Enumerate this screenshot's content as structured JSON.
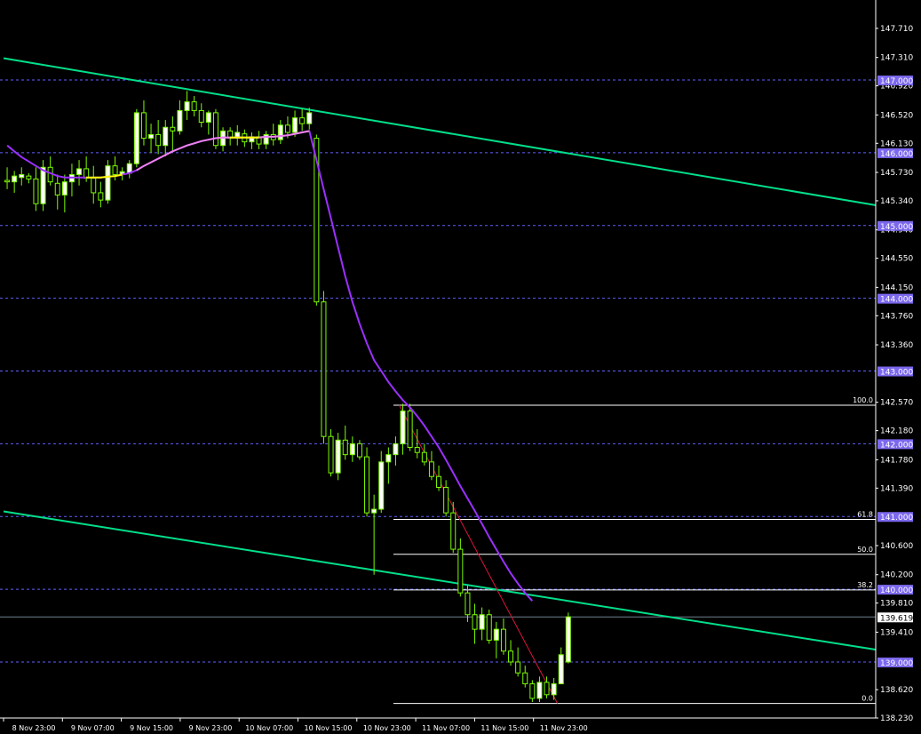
{
  "chart_data": {
    "type": "candlestick",
    "colors": {
      "background": "#000000",
      "frame": "#ffffff",
      "bull_body": "#ffffff",
      "bull_border": "#7cfc00",
      "bear_body": "#000000",
      "wick": "#7cfc00",
      "channel": "#00e08a",
      "moving_average": "#9b30ff",
      "moving_average_light": "#ee82ee",
      "moving_average_flat": "#ffff00",
      "fib": "#ffffff",
      "trend": "#dc143c",
      "round_level": "#6060ff",
      "round_tag": "#7b68ee",
      "current_price_line": "#708090"
    },
    "y_range": [
      138.23,
      148.1
    ],
    "y_ticks": [
      "147.710",
      "147.310",
      "146.920",
      "146.520",
      "146.130",
      "145.730",
      "145.340",
      "144.940",
      "144.550",
      "144.150",
      "143.760",
      "143.360",
      "142.570",
      "142.180",
      "141.780",
      "141.390",
      "140.600",
      "140.200",
      "139.810",
      "139.410",
      "138.620",
      "138.230"
    ],
    "round_levels": [
      "147.000",
      "146.000",
      "145.000",
      "144.000",
      "143.000",
      "142.000",
      "141.000",
      "140.000",
      "139.000"
    ],
    "current_price": "139.619",
    "x_labels": [
      "8 Nov 23:00",
      "9 Nov 07:00",
      "9 Nov 15:00",
      "9 Nov 23:00",
      "10 Nov 07:00",
      "10 Nov 15:00",
      "10 Nov 23:00",
      "11 Nov 07:00",
      "11 Nov 15:00",
      "11 Nov 23:00"
    ],
    "fib_levels": [
      {
        "label": "100.0",
        "price": 142.53
      },
      {
        "label": "61.8",
        "price": 140.96
      },
      {
        "label": "50.0",
        "price": 140.48
      },
      {
        "label": "38.2",
        "price": 139.99
      },
      {
        "label": "0.0",
        "price": 138.43
      }
    ],
    "channel_lines": [
      {
        "from_bar": 0,
        "from_price": 147.3,
        "to_bar": 121.2,
        "to_price": 145.28
      },
      {
        "from_bar": 0,
        "from_price": 141.07,
        "to_bar": 121.2,
        "to_price": 139.17
      }
    ],
    "trend_line": {
      "from_bar": 55,
      "from_price": 142.53,
      "to_bar": 77,
      "to_price": 138.43
    },
    "candles": [
      {
        "o": 145.62,
        "h": 145.8,
        "l": 145.5,
        "c": 145.6
      },
      {
        "o": 145.6,
        "h": 145.75,
        "l": 145.45,
        "c": 145.68
      },
      {
        "o": 145.66,
        "h": 145.8,
        "l": 145.55,
        "c": 145.7
      },
      {
        "o": 145.68,
        "h": 145.72,
        "l": 145.58,
        "c": 145.64
      },
      {
        "o": 145.64,
        "h": 145.8,
        "l": 145.2,
        "c": 145.3
      },
      {
        "o": 145.3,
        "h": 145.9,
        "l": 145.2,
        "c": 145.8
      },
      {
        "o": 145.8,
        "h": 145.95,
        "l": 145.55,
        "c": 145.6
      },
      {
        "o": 145.58,
        "h": 145.7,
        "l": 145.22,
        "c": 145.42
      },
      {
        "o": 145.42,
        "h": 145.7,
        "l": 145.18,
        "c": 145.6
      },
      {
        "o": 145.6,
        "h": 145.85,
        "l": 145.4,
        "c": 145.7
      },
      {
        "o": 145.7,
        "h": 145.9,
        "l": 145.55,
        "c": 145.78
      },
      {
        "o": 145.78,
        "h": 145.95,
        "l": 145.6,
        "c": 145.65
      },
      {
        "o": 145.65,
        "h": 145.82,
        "l": 145.3,
        "c": 145.45
      },
      {
        "o": 145.45,
        "h": 145.6,
        "l": 145.25,
        "c": 145.35
      },
      {
        "o": 145.35,
        "h": 145.9,
        "l": 145.3,
        "c": 145.82
      },
      {
        "o": 145.82,
        "h": 145.95,
        "l": 145.62,
        "c": 145.7
      },
      {
        "o": 145.7,
        "h": 145.8,
        "l": 145.62,
        "c": 145.74
      },
      {
        "o": 145.72,
        "h": 145.9,
        "l": 145.65,
        "c": 145.85
      },
      {
        "o": 145.85,
        "h": 146.6,
        "l": 145.8,
        "c": 146.55
      },
      {
        "o": 146.55,
        "h": 146.72,
        "l": 146.1,
        "c": 146.2
      },
      {
        "o": 146.2,
        "h": 146.4,
        "l": 146.0,
        "c": 146.25
      },
      {
        "o": 146.25,
        "h": 146.45,
        "l": 145.98,
        "c": 146.1
      },
      {
        "o": 146.1,
        "h": 146.45,
        "l": 145.95,
        "c": 146.35
      },
      {
        "o": 146.35,
        "h": 146.5,
        "l": 146.02,
        "c": 146.3
      },
      {
        "o": 146.3,
        "h": 146.72,
        "l": 146.25,
        "c": 146.58
      },
      {
        "o": 146.58,
        "h": 146.85,
        "l": 146.45,
        "c": 146.7
      },
      {
        "o": 146.7,
        "h": 146.78,
        "l": 146.5,
        "c": 146.58
      },
      {
        "o": 146.58,
        "h": 146.68,
        "l": 146.35,
        "c": 146.42
      },
      {
        "o": 146.42,
        "h": 146.58,
        "l": 146.25,
        "c": 146.55
      },
      {
        "o": 146.55,
        "h": 146.6,
        "l": 146.05,
        "c": 146.1
      },
      {
        "o": 146.1,
        "h": 146.35,
        "l": 146.02,
        "c": 146.3
      },
      {
        "o": 146.3,
        "h": 146.35,
        "l": 146.1,
        "c": 146.2
      },
      {
        "o": 146.2,
        "h": 146.38,
        "l": 146.1,
        "c": 146.28
      },
      {
        "o": 146.26,
        "h": 146.32,
        "l": 146.08,
        "c": 146.15
      },
      {
        "o": 146.15,
        "h": 146.28,
        "l": 146.05,
        "c": 146.22
      },
      {
        "o": 146.22,
        "h": 146.3,
        "l": 146.05,
        "c": 146.12
      },
      {
        "o": 146.12,
        "h": 146.3,
        "l": 146.05,
        "c": 146.25
      },
      {
        "o": 146.25,
        "h": 146.4,
        "l": 146.1,
        "c": 146.18
      },
      {
        "o": 146.18,
        "h": 146.45,
        "l": 146.12,
        "c": 146.38
      },
      {
        "o": 146.38,
        "h": 146.5,
        "l": 146.2,
        "c": 146.28
      },
      {
        "o": 146.28,
        "h": 146.58,
        "l": 146.22,
        "c": 146.48
      },
      {
        "o": 146.48,
        "h": 146.6,
        "l": 146.3,
        "c": 146.4
      },
      {
        "o": 146.4,
        "h": 146.62,
        "l": 146.32,
        "c": 146.55
      },
      {
        "o": 146.2,
        "h": 146.25,
        "l": 143.9,
        "c": 143.95
      },
      {
        "o": 143.95,
        "h": 144.1,
        "l": 142.0,
        "c": 142.1
      },
      {
        "o": 142.1,
        "h": 142.2,
        "l": 141.55,
        "c": 141.6
      },
      {
        "o": 141.6,
        "h": 142.15,
        "l": 141.5,
        "c": 142.05
      },
      {
        "o": 142.05,
        "h": 142.25,
        "l": 141.78,
        "c": 141.85
      },
      {
        "o": 141.85,
        "h": 142.1,
        "l": 141.75,
        "c": 142.0
      },
      {
        "o": 142.0,
        "h": 142.05,
        "l": 141.78,
        "c": 141.82
      },
      {
        "o": 141.82,
        "h": 141.95,
        "l": 141.0,
        "c": 141.05
      },
      {
        "o": 141.05,
        "h": 141.3,
        "l": 140.2,
        "c": 141.1
      },
      {
        "o": 141.1,
        "h": 141.9,
        "l": 141.05,
        "c": 141.75
      },
      {
        "o": 141.75,
        "h": 141.95,
        "l": 141.45,
        "c": 141.85
      },
      {
        "o": 141.85,
        "h": 142.1,
        "l": 141.7,
        "c": 142.0
      },
      {
        "o": 142.0,
        "h": 142.55,
        "l": 141.85,
        "c": 142.45
      },
      {
        "o": 142.45,
        "h": 142.55,
        "l": 141.9,
        "c": 141.95
      },
      {
        "o": 141.95,
        "h": 142.2,
        "l": 141.8,
        "c": 141.88
      },
      {
        "o": 141.88,
        "h": 142.0,
        "l": 141.7,
        "c": 141.75
      },
      {
        "o": 141.75,
        "h": 141.9,
        "l": 141.5,
        "c": 141.55
      },
      {
        "o": 141.55,
        "h": 141.7,
        "l": 141.35,
        "c": 141.4
      },
      {
        "o": 141.4,
        "h": 141.5,
        "l": 141.0,
        "c": 141.05
      },
      {
        "o": 141.05,
        "h": 141.2,
        "l": 140.5,
        "c": 140.55
      },
      {
        "o": 140.55,
        "h": 140.7,
        "l": 139.9,
        "c": 139.95
      },
      {
        "o": 139.95,
        "h": 140.05,
        "l": 139.55,
        "c": 139.65
      },
      {
        "o": 139.65,
        "h": 139.8,
        "l": 139.25,
        "c": 139.45
      },
      {
        "o": 139.45,
        "h": 139.75,
        "l": 139.3,
        "c": 139.65
      },
      {
        "o": 139.65,
        "h": 139.72,
        "l": 139.25,
        "c": 139.3
      },
      {
        "o": 139.3,
        "h": 139.55,
        "l": 139.05,
        "c": 139.45
      },
      {
        "o": 139.45,
        "h": 139.6,
        "l": 139.1,
        "c": 139.15
      },
      {
        "o": 139.15,
        "h": 139.3,
        "l": 138.95,
        "c": 139.0
      },
      {
        "o": 139.0,
        "h": 139.2,
        "l": 138.8,
        "c": 138.85
      },
      {
        "o": 138.85,
        "h": 138.95,
        "l": 138.65,
        "c": 138.7
      },
      {
        "o": 138.7,
        "h": 138.75,
        "l": 138.45,
        "c": 138.5
      },
      {
        "o": 138.5,
        "h": 138.8,
        "l": 138.45,
        "c": 138.72
      },
      {
        "o": 138.72,
        "h": 138.8,
        "l": 138.5,
        "c": 138.55
      },
      {
        "o": 138.55,
        "h": 138.78,
        "l": 138.48,
        "c": 138.7
      },
      {
        "o": 138.7,
        "h": 139.2,
        "l": 138.95,
        "c": 139.1
      },
      {
        "o": 139.0,
        "h": 139.68,
        "l": 138.98,
        "c": 139.62
      }
    ],
    "moving_average": [
      146.1,
      146.02,
      145.94,
      145.88,
      145.82,
      145.76,
      145.72,
      145.68,
      145.66,
      145.66,
      145.66,
      145.66,
      145.66,
      145.66,
      145.67,
      145.68,
      145.7,
      145.72,
      145.76,
      145.82,
      145.87,
      145.92,
      145.97,
      146.02,
      146.06,
      146.1,
      146.13,
      146.16,
      146.18,
      146.2,
      146.21,
      146.21,
      146.21,
      146.21,
      146.21,
      146.21,
      146.22,
      146.22,
      146.23,
      146.24,
      146.26,
      146.28,
      146.3,
      145.9,
      145.5,
      145.1,
      144.7,
      144.3,
      143.95,
      143.65,
      143.38,
      143.15,
      143.0,
      142.85,
      142.72,
      142.6,
      142.5,
      142.38,
      142.25,
      142.1,
      141.95,
      141.78,
      141.6,
      141.42,
      141.25,
      141.08,
      140.9,
      140.72,
      140.55,
      140.38,
      140.22,
      140.08,
      139.95,
      139.84
    ]
  }
}
